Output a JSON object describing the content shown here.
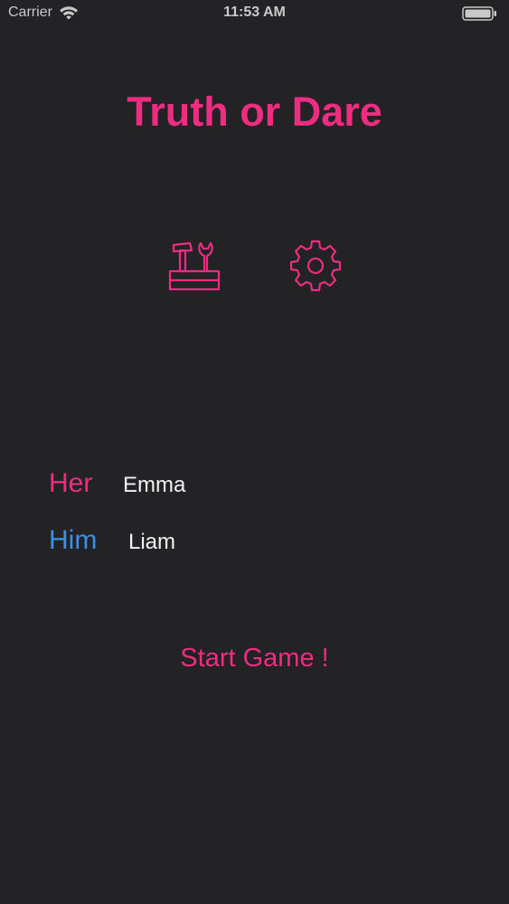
{
  "status_bar": {
    "carrier": "Carrier",
    "time": "11:53 AM",
    "icons": [
      "wifi-icon",
      "battery-icon"
    ]
  },
  "app": {
    "title": "Truth or Dare",
    "accent_color": "#ee2d82",
    "secondary_color": "#3a8fe8",
    "background_color": "#232224"
  },
  "icons": {
    "toolbox": "toolbox-icon",
    "settings": "gear-icon"
  },
  "players": {
    "her": {
      "label": "Her",
      "name": "Emma"
    },
    "him": {
      "label": "Him",
      "name": "Liam"
    }
  },
  "actions": {
    "start_label": "Start Game !"
  }
}
